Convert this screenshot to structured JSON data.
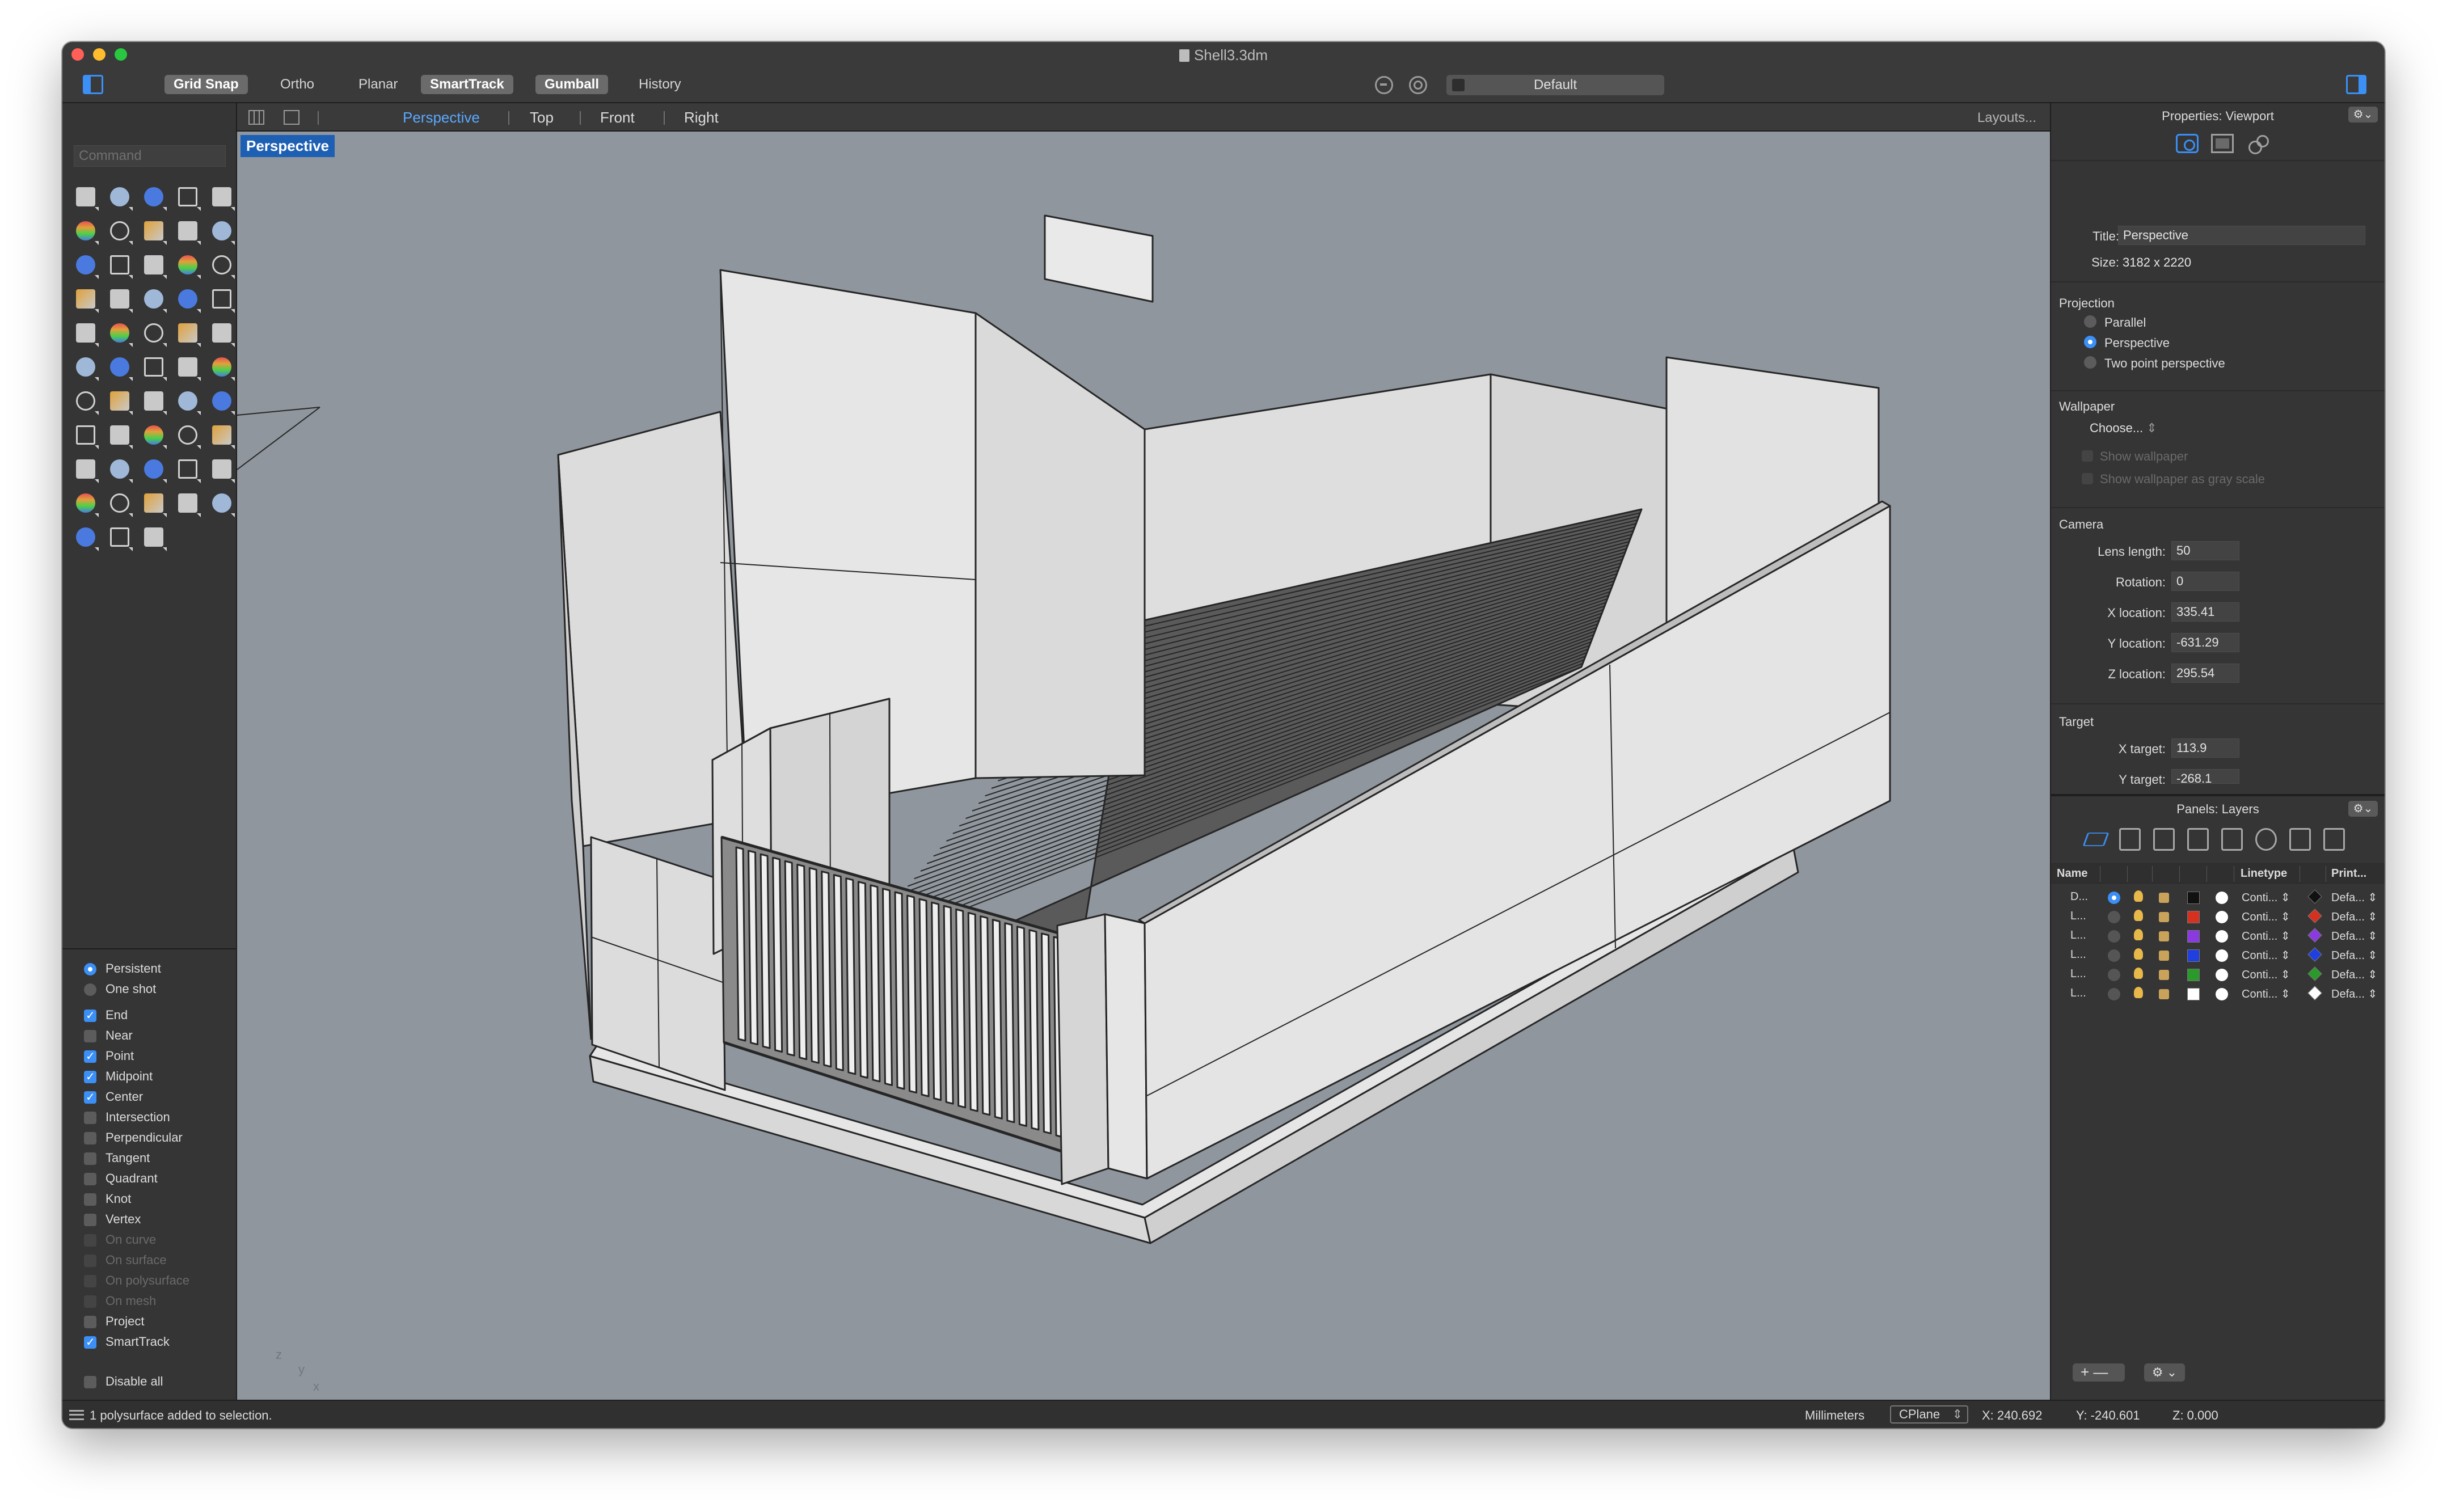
{
  "window": {
    "title": "Shell3.3dm"
  },
  "toolbar": {
    "buttons": [
      {
        "label": "Grid Snap",
        "on": true
      },
      {
        "label": "Ortho",
        "on": false
      },
      {
        "label": "Planar",
        "on": false
      },
      {
        "label": "SmartTrack",
        "on": true
      },
      {
        "label": "Gumball",
        "on": true
      },
      {
        "label": "History",
        "on": false
      }
    ],
    "display_mode": "Default"
  },
  "command": {
    "placeholder": "Command"
  },
  "tools": [
    "select-arrow-icon",
    "point-icon",
    "polyline-icon",
    "curve-icon",
    "circle-icon",
    "ellipse-icon",
    "arc-icon",
    "rectangle-icon",
    "polygon-icon",
    "fillet-curve-icon",
    "surface-icon",
    "box-icon",
    "sphere-icon",
    "solid-icon",
    "extrude-icon",
    "plane-surface-icon",
    "explode-icon",
    "trim-icon",
    "split-icon",
    "boolean-icon",
    "array-icon",
    "join-icon",
    "rotate-icon",
    "scale-icon",
    "mirror-icon",
    "move-icon",
    "group-icon",
    "analyze-icon",
    "dimension-icon",
    "text-icon",
    "grid-array-icon",
    "layer-icon",
    "cage-icon",
    "check-icon",
    "mesh-icon",
    "paint-icon",
    "zoom-icon",
    "zoom-window-icon",
    "zoom-extents-icon",
    "light-icon",
    "camera-icon",
    "car-icon",
    "car-wire-icon",
    "spotlight-icon",
    "lightbulb-icon",
    "lock-icon",
    "material-icon",
    "color-wheel-icon",
    "render-sphere-icon",
    "environment-icon",
    "render-icon",
    "flag-icon",
    "crop-icon"
  ],
  "osnap": {
    "mode": [
      {
        "label": "Persistent",
        "selected": true
      },
      {
        "label": "One shot",
        "selected": false
      }
    ],
    "snaps": [
      {
        "label": "End",
        "checked": true,
        "enabled": true
      },
      {
        "label": "Near",
        "checked": false,
        "enabled": true
      },
      {
        "label": "Point",
        "checked": true,
        "enabled": true
      },
      {
        "label": "Midpoint",
        "checked": true,
        "enabled": true
      },
      {
        "label": "Center",
        "checked": true,
        "enabled": true
      },
      {
        "label": "Intersection",
        "checked": false,
        "enabled": true
      },
      {
        "label": "Perpendicular",
        "checked": false,
        "enabled": true
      },
      {
        "label": "Tangent",
        "checked": false,
        "enabled": true
      },
      {
        "label": "Quadrant",
        "checked": false,
        "enabled": true
      },
      {
        "label": "Knot",
        "checked": false,
        "enabled": true
      },
      {
        "label": "Vertex",
        "checked": false,
        "enabled": true
      },
      {
        "label": "On curve",
        "checked": false,
        "enabled": false
      },
      {
        "label": "On surface",
        "checked": false,
        "enabled": false
      },
      {
        "label": "On polysurface",
        "checked": false,
        "enabled": false
      },
      {
        "label": "On mesh",
        "checked": false,
        "enabled": false
      },
      {
        "label": "Project",
        "checked": false,
        "enabled": true
      },
      {
        "label": "SmartTrack",
        "checked": true,
        "enabled": true
      }
    ],
    "disable_all": "Disable all"
  },
  "viewtabs": {
    "tabs": [
      "Perspective",
      "Top",
      "Front",
      "Right"
    ],
    "active": "Perspective",
    "layouts": "Layouts..."
  },
  "viewport": {
    "label": "Perspective",
    "axes": {
      "z": "z",
      "y": "y",
      "x": "x"
    },
    "colors": {
      "background": "#8f969d",
      "face": "#e4e4e4",
      "edge": "#262626"
    }
  },
  "properties": {
    "title": "Properties: Viewport",
    "gear": "⚙⌄",
    "title_label": "Title:",
    "title_value": "Perspective",
    "size_label": "Size:",
    "size_value": "3182 x 2220",
    "projection": {
      "heading": "Projection",
      "options": [
        {
          "label": "Parallel",
          "selected": false
        },
        {
          "label": "Perspective",
          "selected": true
        },
        {
          "label": "Two point perspective",
          "selected": false
        }
      ]
    },
    "wallpaper": {
      "heading": "Wallpaper",
      "choose": "Choose...",
      "show": "Show wallpaper",
      "gray": "Show wallpaper as gray scale"
    },
    "camera": {
      "heading": "Camera",
      "lens_label": "Lens length:",
      "lens": "50",
      "rotation_label": "Rotation:",
      "rotation": "0",
      "x_label": "X location:",
      "x": "335.41",
      "y_label": "Y location:",
      "y": "-631.29",
      "z_label": "Z location:",
      "z": "295.54"
    },
    "target": {
      "heading": "Target",
      "x_label": "X target:",
      "x": "113.9",
      "y_label": "Y target:",
      "y": "-268.1"
    }
  },
  "layers": {
    "title": "Panels: Layers",
    "gear": "⚙⌄",
    "headers": {
      "name": "Name",
      "linetype": "Linetype",
      "print": "Print..."
    },
    "rows": [
      {
        "name": "D...",
        "current": true,
        "color": "#111111",
        "print_color": "#111111",
        "linetype": "Conti... ⇕",
        "print_width": "Defa... ⇕"
      },
      {
        "name": "L...",
        "current": false,
        "color": "#d6301f",
        "print_color": "#d6301f",
        "linetype": "Conti... ⇕",
        "print_width": "Defa... ⇕"
      },
      {
        "name": "L...",
        "current": false,
        "color": "#8a3ae0",
        "print_color": "#8a3ae0",
        "linetype": "Conti... ⇕",
        "print_width": "Defa... ⇕"
      },
      {
        "name": "L...",
        "current": false,
        "color": "#1f3fe0",
        "print_color": "#1f3fe0",
        "linetype": "Conti... ⇕",
        "print_width": "Defa... ⇕"
      },
      {
        "name": "L...",
        "current": false,
        "color": "#2a9a2a",
        "print_color": "#2a9a2a",
        "linetype": "Conti... ⇕",
        "print_width": "Defa... ⇕"
      },
      {
        "name": "L...",
        "current": false,
        "color": "#ffffff",
        "print_color": "#ffffff",
        "linetype": "Conti... ⇕",
        "print_width": "Defa... ⇕"
      }
    ],
    "add": "+ —",
    "tools": "⚙ ⌄"
  },
  "status": {
    "message": "1 polysurface added to selection.",
    "units": "Millimeters",
    "cplane": "CPlane",
    "x": "X: 240.692",
    "y": "Y: -240.601",
    "z": "Z: 0.000"
  }
}
